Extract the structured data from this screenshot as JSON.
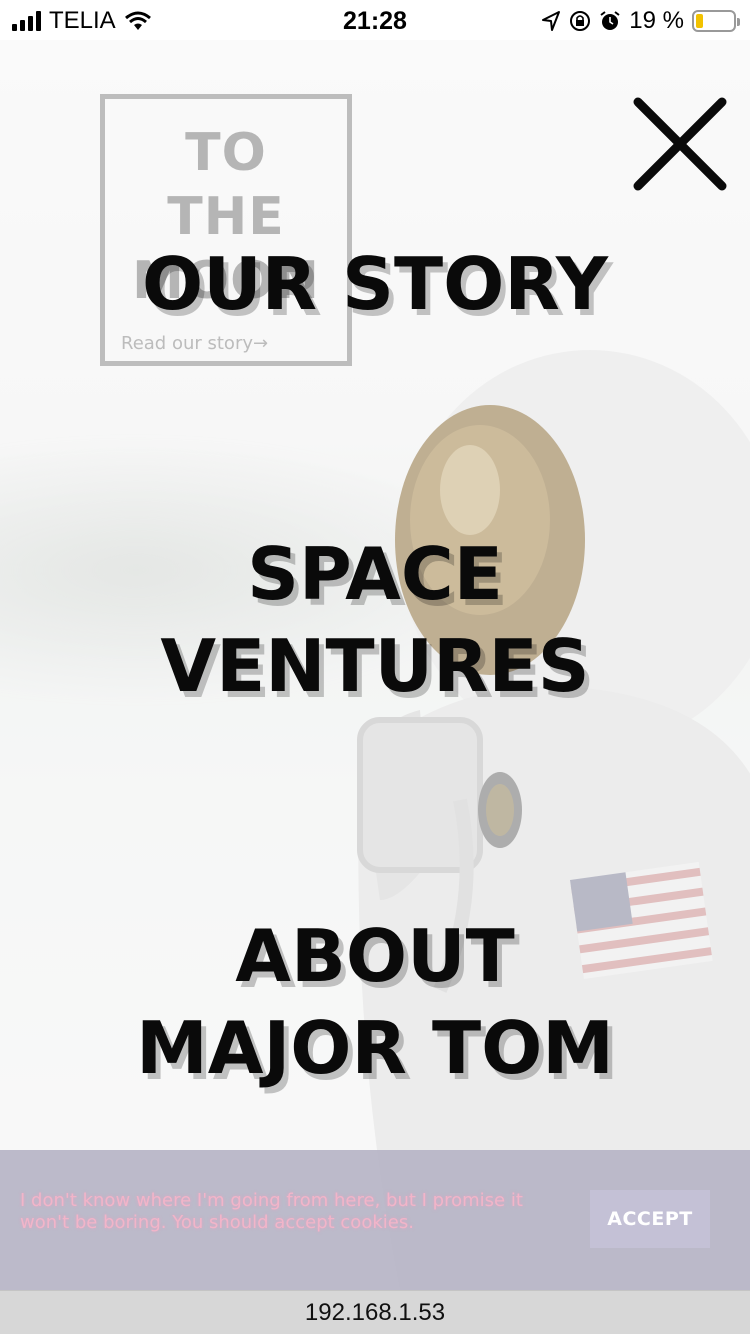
{
  "status_bar": {
    "carrier": "TELIA",
    "time": "21:28",
    "battery_percent": "19 %",
    "battery_level": 0.19,
    "icons": [
      "signal-icon",
      "wifi-icon",
      "location-icon",
      "rotation-lock-icon",
      "alarm-icon",
      "battery-icon"
    ]
  },
  "logo": {
    "line1": "TO",
    "line2": "THE",
    "line3": "MOON",
    "link": "Read our story→"
  },
  "menu": {
    "items": [
      {
        "line1": "OUR STORY",
        "line2": ""
      },
      {
        "line1": "SPACE",
        "line2": "VENTURES"
      },
      {
        "line1": "ABOUT",
        "line2": "MAJOR TOM"
      }
    ]
  },
  "cookie_banner": {
    "text": "I don't know where I'm going from here, but I promise it won't be boring. You should accept cookies.",
    "accept_label": "ACCEPT"
  },
  "browser": {
    "url": "192.168.1.53"
  },
  "colors": {
    "menu_text": "#0a0a0a",
    "cookie_bg": "#b6b4c6",
    "cookie_text": "#f2b5c9",
    "battery_fill": "#f2c200"
  }
}
